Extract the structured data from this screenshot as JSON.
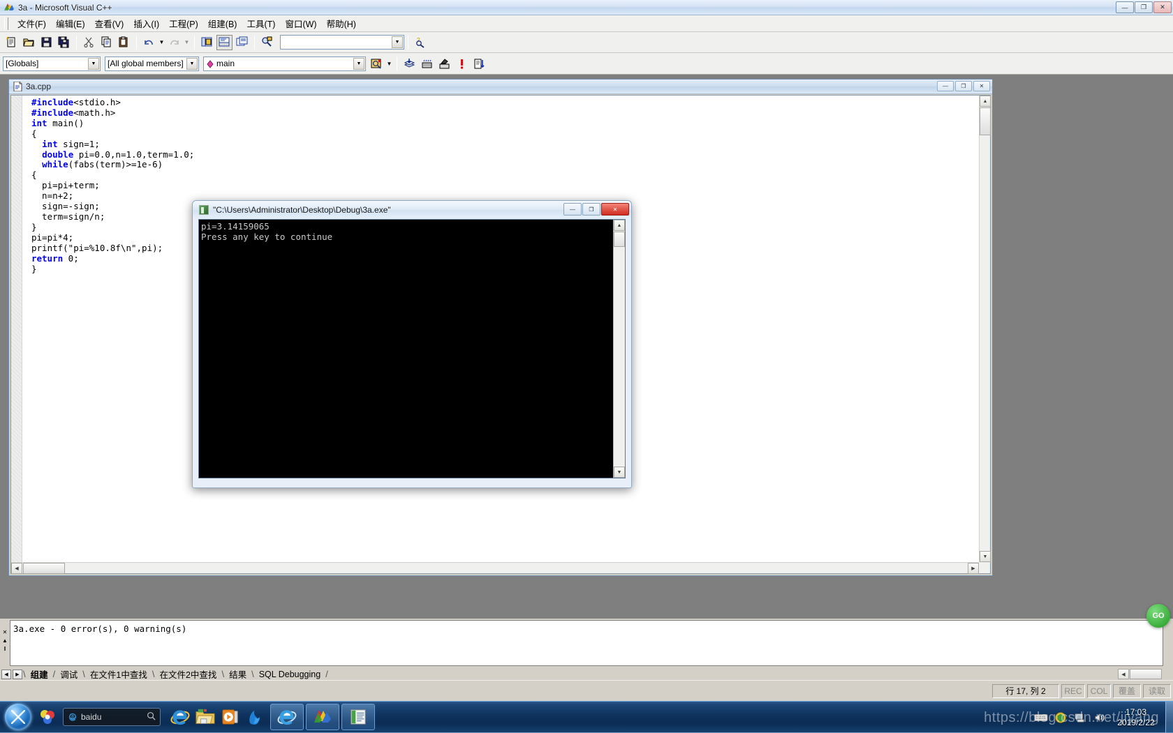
{
  "app": {
    "title": "3a - Microsoft Visual C++",
    "icon": "vcpp-icon",
    "window_buttons": {
      "minimize": "—",
      "maximize": "❐",
      "close": "✕"
    }
  },
  "menubar": {
    "items": [
      {
        "label": "文件(F)",
        "name": "menu-file"
      },
      {
        "label": "编辑(E)",
        "name": "menu-edit"
      },
      {
        "label": "查看(V)",
        "name": "menu-view"
      },
      {
        "label": "插入(I)",
        "name": "menu-insert"
      },
      {
        "label": "工程(P)",
        "name": "menu-project"
      },
      {
        "label": "组建(B)",
        "name": "menu-build"
      },
      {
        "label": "工具(T)",
        "name": "menu-tools"
      },
      {
        "label": "窗口(W)",
        "name": "menu-window"
      },
      {
        "label": "帮助(H)",
        "name": "menu-help"
      }
    ]
  },
  "toolbar_standard": {
    "buttons": [
      "new-document-icon",
      "open-folder-icon",
      "save-icon",
      "save-all-icon",
      "cut-scissors-icon",
      "copy-icon",
      "paste-icon",
      "undo-icon",
      "redo-icon",
      "workspace-icon",
      "output-window-icon",
      "window-list-icon",
      "find-in-files-icon"
    ],
    "search_box": {
      "value": "",
      "placeholder": ""
    },
    "help_button": "find-help-icon"
  },
  "toolbar_wizardbar": {
    "class_combo": {
      "value": "[Globals]"
    },
    "members_combo": {
      "value": "[All global members]"
    },
    "function_combo": {
      "value": "main"
    },
    "action_button": "wizardbar-action-icon",
    "build_buttons": [
      "compile-icon",
      "build-icon",
      "stop-build-icon",
      "execute-icon",
      "go-icon"
    ]
  },
  "document_window": {
    "title": "3a.cpp",
    "icon": "cpp-file-icon",
    "buttons": {
      "minimize": "—",
      "restore": "❐",
      "close": "✕"
    },
    "code_lines": [
      [
        {
          "t": "#include",
          "k": true
        },
        {
          "t": "<stdio.h>",
          "k": false
        }
      ],
      [
        {
          "t": "#include",
          "k": true
        },
        {
          "t": "<math.h>",
          "k": false
        }
      ],
      [
        {
          "t": "int",
          "k": true
        },
        {
          "t": " main()",
          "k": false
        }
      ],
      [
        {
          "t": "{",
          "k": false
        }
      ],
      [
        {
          "t": "  ",
          "k": false
        },
        {
          "t": "int",
          "k": true
        },
        {
          "t": " sign=1;",
          "k": false
        }
      ],
      [
        {
          "t": "  ",
          "k": false
        },
        {
          "t": "double",
          "k": true
        },
        {
          "t": " pi=0.0,n=1.0,term=1.0;",
          "k": false
        }
      ],
      [
        {
          "t": "  ",
          "k": false
        },
        {
          "t": "while",
          "k": true
        },
        {
          "t": "(fabs(term)>=1e-6)",
          "k": false
        }
      ],
      [
        {
          "t": "{",
          "k": false
        }
      ],
      [
        {
          "t": "  pi=pi+term;",
          "k": false
        }
      ],
      [
        {
          "t": "  n=n+2;",
          "k": false
        }
      ],
      [
        {
          "t": "  sign=-sign;",
          "k": false
        }
      ],
      [
        {
          "t": "  term=sign/n;",
          "k": false
        }
      ],
      [
        {
          "t": "}",
          "k": false
        }
      ],
      [
        {
          "t": "pi=pi*4;",
          "k": false
        }
      ],
      [
        {
          "t": "printf(\"pi=%10.8f\\n\",pi);",
          "k": false
        }
      ],
      [
        {
          "t": "return",
          "k": true
        },
        {
          "t": " 0;",
          "k": false
        }
      ],
      [
        {
          "t": "}",
          "k": false
        }
      ]
    ]
  },
  "console_window": {
    "title": "\"C:\\Users\\Administrator\\Desktop\\Debug\\3a.exe\"",
    "icon": "console-icon",
    "buttons": {
      "minimize": "—",
      "maximize": "❐",
      "close": "✕"
    },
    "output_lines": [
      "pi=3.14159065",
      "Press any key to continue"
    ]
  },
  "output_pane": {
    "text": "3a.exe - 0 error(s), 0 warning(s)",
    "close_icon": "close-icon",
    "scroll_up_icon": "scroll-up-icon",
    "tabs": [
      {
        "label": "组建",
        "active": true
      },
      {
        "label": "调试",
        "active": false
      },
      {
        "label": "在文件1中查找",
        "active": false
      },
      {
        "label": "在文件2中查找",
        "active": false
      },
      {
        "label": "结果",
        "active": false
      },
      {
        "label": "SQL Debugging",
        "active": false
      }
    ]
  },
  "statusbar": {
    "message": "",
    "position": "行 17, 列 2",
    "indicators": [
      "REC",
      "COL",
      "覆盖",
      "读取"
    ]
  },
  "taskbar": {
    "start_button": "windows-start-orb",
    "quick_launch": [
      "kingsoft-icon"
    ],
    "search_box": {
      "value": "baidu",
      "icon": "ie-icon",
      "search_icon": "search-icon"
    },
    "pinned": [
      "ie-icon",
      "explorer-folder-icon",
      "media-player-icon",
      "kingsoft-pdf-icon"
    ],
    "running": [
      "ie-window-icon",
      "visual-cpp-window-icon",
      "console-window-icon"
    ],
    "tray_icons": [
      "keyboard-icon",
      "shield-icon",
      "network-icon",
      "volume-icon"
    ],
    "clock": {
      "time": "17:03",
      "date": "2019/2/22"
    },
    "show_desktop": "show-desktop-button"
  },
  "overlay": {
    "watermark": "https://blog.csdn.net/jiyang",
    "badge": "GO"
  },
  "colors": {
    "keyword_blue": "#0000ff",
    "console_bg": "#000000",
    "ide_face": "#d4d0c8",
    "mdi_back": "#7f7f7f",
    "taskbar_blue": "#0f3460"
  }
}
